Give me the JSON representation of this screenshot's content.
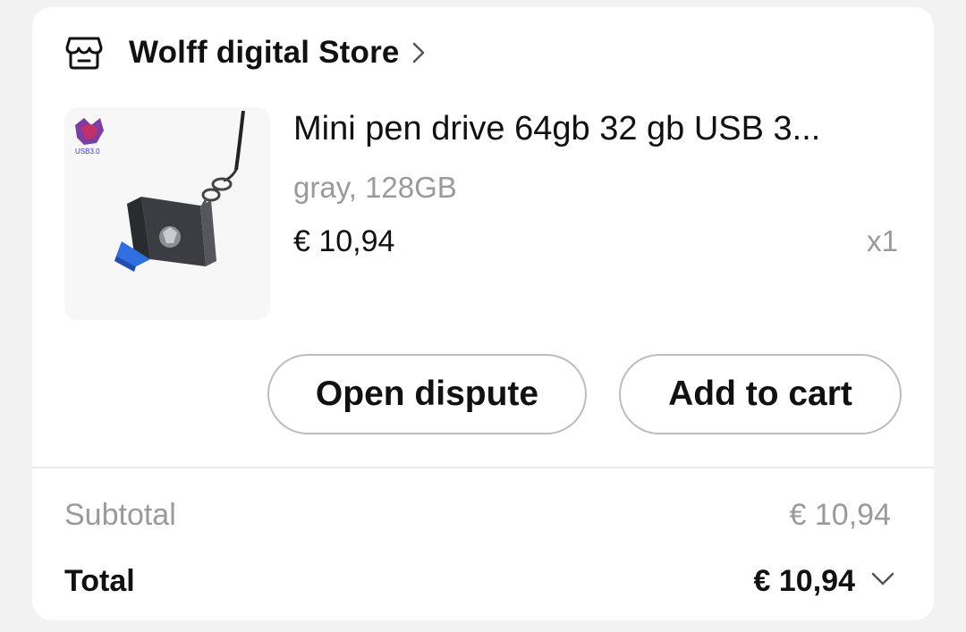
{
  "store": {
    "name": "Wolff digital Store",
    "icon": "store-icon",
    "chevron_icon": "chevron-right-icon"
  },
  "product": {
    "title": "Mini pen drive 64gb 32 gb USB 3...",
    "variant": "gray, 128GB",
    "price": "€ 10,94",
    "quantity": "x1",
    "image_badge_text": "USB3.0"
  },
  "actions": {
    "open_dispute_label": "Open dispute",
    "add_to_cart_label": "Add to cart"
  },
  "summary": {
    "subtotal_label": "Subtotal",
    "subtotal_value": "€ 10,94",
    "total_label": "Total",
    "total_value": "€ 10,94",
    "expand_icon": "chevron-down-icon"
  },
  "colors": {
    "background": "#f2f2f2",
    "card": "#ffffff",
    "muted_text": "#9a9a9a",
    "button_border": "#bdbdbd",
    "usb_accent": "#2f6fe0"
  }
}
